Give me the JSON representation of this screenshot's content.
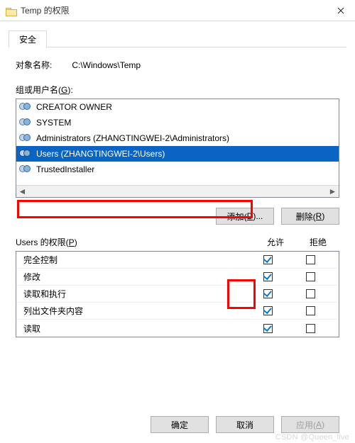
{
  "window": {
    "title": "Temp 的权限"
  },
  "tab": {
    "label": "安全"
  },
  "object": {
    "label": "对象名称:",
    "value": "C:\\Windows\\Temp"
  },
  "groups": {
    "label_pre": "组或用户名(",
    "accel": "G",
    "label_post": "):",
    "items": [
      "CREATOR OWNER",
      "SYSTEM",
      "Administrators (ZHANGTINGWEI-2\\Administrators)",
      "Users (ZHANGTINGWEI-2\\Users)",
      "TrustedInstaller"
    ],
    "selected_index": 3
  },
  "buttons": {
    "add_pre": "添加(",
    "add_accel": "D",
    "add_post": ")...",
    "remove_pre": "删除(",
    "remove_accel": "R",
    "remove_post": ")"
  },
  "perm": {
    "header_pre": "Users 的权限(",
    "header_accel": "P",
    "header_post": ")",
    "col_allow": "允许",
    "col_deny": "拒绝",
    "rows": [
      {
        "name": "完全控制",
        "allow": true,
        "deny": false
      },
      {
        "name": "修改",
        "allow": true,
        "deny": false
      },
      {
        "name": "读取和执行",
        "allow": true,
        "deny": false
      },
      {
        "name": "列出文件夹内容",
        "allow": true,
        "deny": false
      },
      {
        "name": "读取",
        "allow": true,
        "deny": false
      }
    ]
  },
  "footer": {
    "ok": "确定",
    "cancel": "取消",
    "apply_pre": "应用(",
    "apply_accel": "A",
    "apply_post": ")"
  },
  "watermark": "CSDN @Queen_live"
}
